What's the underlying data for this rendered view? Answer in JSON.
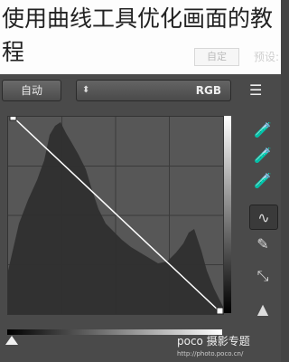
{
  "title": {
    "text": "使用曲线工具优化画面的教程"
  },
  "header": {
    "preset_label": "预设:",
    "preset_value": "自定"
  },
  "controls": {
    "auto_label": "自动",
    "channel_value": "RGB",
    "channel_arrows": "⬍"
  },
  "watermark": {
    "brand": "poco 摄影专题",
    "url": "http://photo.poco.cn/"
  },
  "curve": {
    "input_output": [
      [
        0,
        255
      ],
      [
        255,
        0
      ]
    ]
  },
  "icons": {
    "sliders": "sliders-icon",
    "tools": [
      "eyedropper-black-icon",
      "eyedropper-gray-icon",
      "eyedropper-white-icon",
      "curve-tool-icon",
      "pencil-icon",
      "smooth-icon",
      "clipping-warning-icon"
    ]
  },
  "colors": {
    "panel": "#4a4a4a",
    "graph": "#575757",
    "histogram": "#2f2f2f",
    "curve": "#ffffff"
  }
}
